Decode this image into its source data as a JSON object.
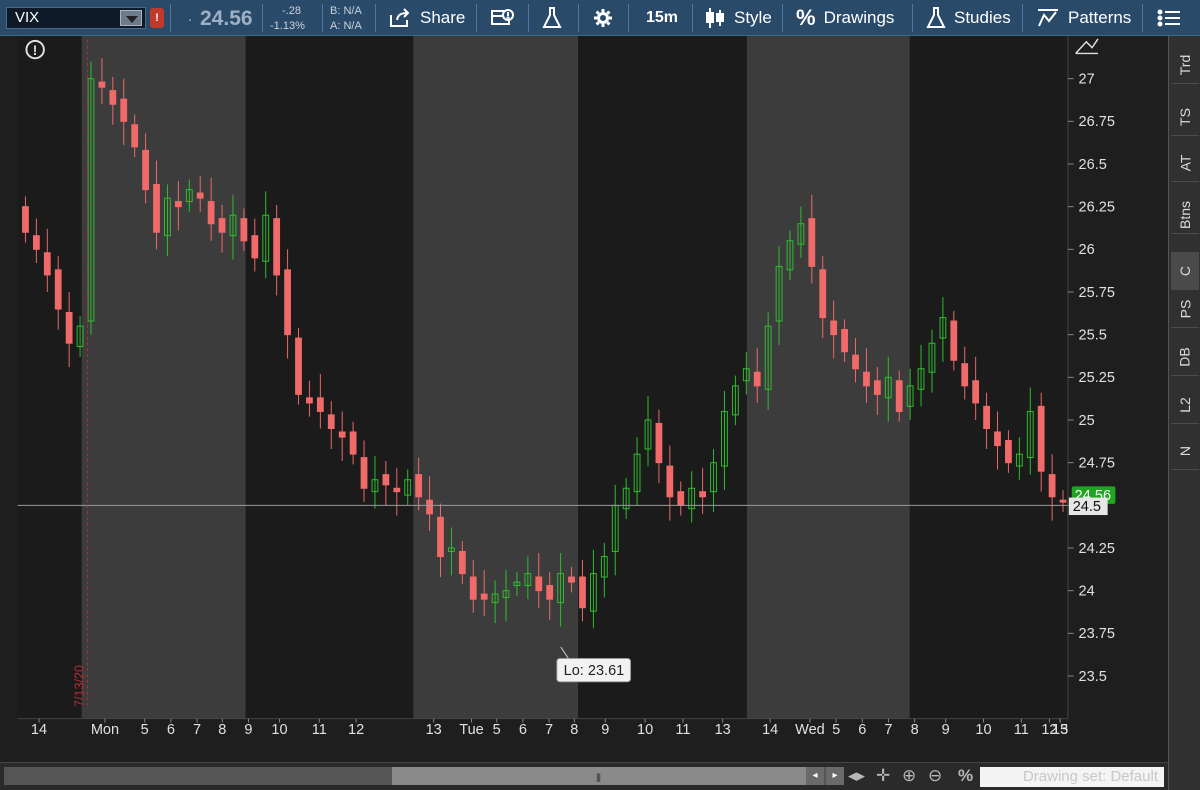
{
  "toolbar": {
    "symbol": "VIX",
    "alert_badge": "!",
    "price_prefix": ".",
    "price": "24.56",
    "change": "-.28",
    "change_pct": "-1.13%",
    "bid": "B: N/A",
    "ask": "A: N/A",
    "share_label": "Share",
    "timeframe_label": "15m",
    "style_label": "Style",
    "drawings_label": "Drawings",
    "studies_label": "Studies",
    "patterns_label": "Patterns"
  },
  "sidebar": {
    "tabs": [
      {
        "label": "Trd"
      },
      {
        "label": "TS"
      },
      {
        "label": "AT"
      },
      {
        "label": "Btns"
      },
      {
        "label": "C"
      },
      {
        "label": "PS"
      },
      {
        "label": "DB"
      },
      {
        "label": "L2"
      },
      {
        "label": "N"
      }
    ],
    "active_tab": "C"
  },
  "chart": {
    "alert_icon": "!",
    "date_marker": "7/13/20",
    "low_label": "Lo: 23.61",
    "last_price_label": "24.56",
    "crosshair_label": "24.5",
    "colors": {
      "up": "#2ec02e",
      "down": "#f06a6a",
      "session_dark": "#1b1b1b",
      "session_light": "#3c3c3c",
      "last_price_badge": "#1fa51f"
    }
  },
  "chart_data": {
    "type": "candlestick",
    "symbol": "VIX",
    "timeframe": "15m",
    "ylim": [
      23.25,
      27.25
    ],
    "yticks": [
      "27",
      "26.75",
      "26.5",
      "26.25",
      "26",
      "25.75",
      "25.5",
      "25.25",
      "25",
      "24.75",
      "24.5",
      "24.25",
      "24",
      "23.75",
      "23.5"
    ],
    "xticks": [
      "14",
      "Mon",
      "5",
      "6",
      "7",
      "8",
      "9",
      "10",
      "11",
      "12",
      "13",
      "Tue",
      "5",
      "6",
      "7",
      "8",
      "9",
      "10",
      "11",
      "13",
      "14",
      "Wed",
      "5",
      "6",
      "7",
      "8",
      "9",
      "10",
      "11",
      "12",
      "13",
      "15"
    ],
    "last_price": 24.56,
    "crosshair_value": 24.5,
    "low": 23.61,
    "close_path": [
      26.1,
      26.0,
      25.85,
      25.65,
      25.45,
      25.55,
      27.0,
      26.95,
      26.85,
      26.75,
      26.6,
      26.35,
      26.1,
      26.3,
      26.25,
      26.35,
      26.3,
      26.15,
      26.1,
      26.2,
      26.05,
      25.95,
      26.2,
      25.85,
      25.5,
      25.15,
      25.1,
      25.05,
      24.95,
      24.9,
      24.8,
      24.6,
      24.65,
      24.62,
      24.58,
      24.65,
      24.55,
      24.45,
      24.2,
      24.25,
      24.1,
      23.95,
      23.95,
      23.98,
      24.0,
      24.05,
      24.1,
      24.0,
      23.95,
      24.1,
      24.05,
      23.9,
      24.1,
      24.2,
      24.5,
      24.6,
      24.8,
      25.0,
      24.75,
      24.55,
      24.5,
      24.6,
      24.55,
      24.75,
      25.05,
      25.2,
      25.3,
      25.2,
      25.55,
      25.9,
      26.05,
      26.15,
      25.9,
      25.6,
      25.5,
      25.4,
      25.3,
      25.2,
      25.15,
      25.25,
      25.05,
      25.2,
      25.3,
      25.45,
      25.6,
      25.35,
      25.2,
      25.1,
      24.95,
      24.85,
      24.75,
      24.8,
      25.05,
      24.7,
      24.55,
      24.52
    ],
    "sessions": [
      "Mon",
      "Tue",
      "Wed"
    ]
  },
  "bottom": {
    "drawing_set": "Drawing set: Default",
    "scroll_grip": "|||"
  }
}
